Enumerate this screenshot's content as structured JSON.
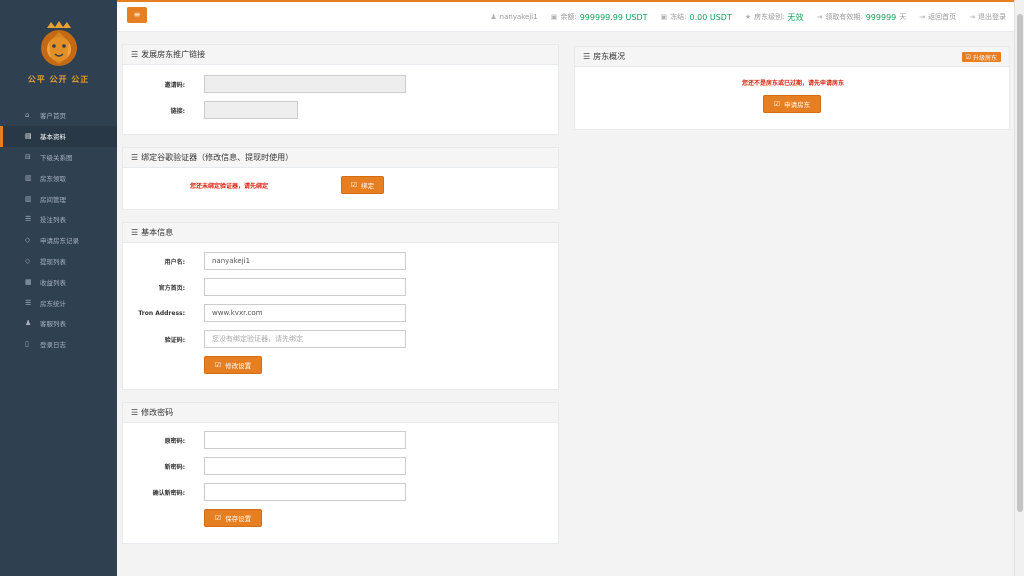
{
  "brand": {
    "motto": "公平 公开 公正"
  },
  "sidebar": {
    "items": [
      {
        "icon": "home-icon",
        "glyph": "⌂",
        "label": "客户首页"
      },
      {
        "icon": "id-card-icon",
        "glyph": "▤",
        "label": "基本资料"
      },
      {
        "icon": "sitemap-icon",
        "glyph": "⊟",
        "label": "下级关系图"
      },
      {
        "icon": "bank-icon",
        "glyph": "▥",
        "label": "房东领取"
      },
      {
        "icon": "bank-icon",
        "glyph": "▥",
        "label": "房间管理"
      },
      {
        "icon": "list-icon",
        "glyph": "☰",
        "label": "投注列表"
      },
      {
        "icon": "diamond-icon",
        "glyph": "◇",
        "label": "申请房东记录"
      },
      {
        "icon": "diamond-icon",
        "glyph": "◇",
        "label": "提现列表"
      },
      {
        "icon": "calendar-icon",
        "glyph": "▦",
        "label": "收益列表"
      },
      {
        "icon": "list-icon",
        "glyph": "☰",
        "label": "房东统计"
      },
      {
        "icon": "users-icon",
        "glyph": "♟",
        "label": "客服列表"
      },
      {
        "icon": "file-icon",
        "glyph": "▯",
        "label": "登录日志"
      }
    ]
  },
  "topbar": {
    "username": "nanyakeji1",
    "balance_label": "余额:",
    "balance_value": "999999.99 USDT",
    "frozen_label": "冻结:",
    "frozen_value": "0.00 USDT",
    "landlord_level_label": "房东级别:",
    "landlord_level_value": "无效",
    "expiry_label": "领取有效期:",
    "expiry_value": "999999",
    "expiry_unit": "天",
    "home_link": "返回首页",
    "logout_link": "退出登录"
  },
  "promo_panel": {
    "title": "发展房东推广链接",
    "invite_label": "邀请码:",
    "invite_value": "",
    "link_label": "链接:",
    "link_value": ""
  },
  "google_auth_panel": {
    "title": "绑定谷歌验证器（修改信息、提现时使用）",
    "warning": "您还未绑定验证器，请先绑定",
    "bind_button": "绑定"
  },
  "basic_info_panel": {
    "title": "基本信息",
    "username_label": "用户名:",
    "username_value": "nanyakeji1",
    "website_label": "官方首页:",
    "website_value": "",
    "tron_label": "Tron Address:",
    "tron_value": "www.kvxr.com",
    "code_label": "验证码:",
    "code_placeholder": "您没有绑定验证器，请先绑定",
    "submit_button": "修改设置"
  },
  "password_panel": {
    "title": "修改密码",
    "old_label": "原密码:",
    "new_label": "新密码:",
    "confirm_label": "确认新密码:",
    "submit_button": "保存设置"
  },
  "overview_panel": {
    "title": "房东概况",
    "upgrade_button": "升级房东",
    "warning": "您还不是房东或已过期，请先申请房东",
    "apply_button": "申请房东"
  },
  "colors": {
    "accent": "#e67e22",
    "sidebar": "#2f4050",
    "positive": "#18a05a",
    "danger": "#d9230f"
  }
}
